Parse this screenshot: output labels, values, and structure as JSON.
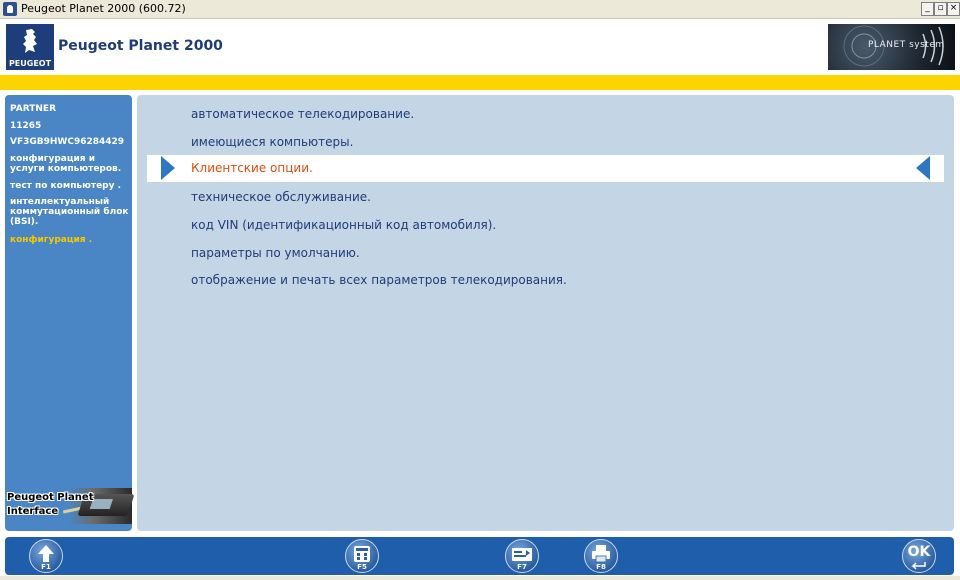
{
  "window": {
    "title": "Peugeot Planet 2000 (600.72)",
    "minimize_label": "_",
    "maximize_label": "▫",
    "close_label": "×"
  },
  "header": {
    "app_title": "Peugeot Planet 2000",
    "brand_text": "PEUGEOT",
    "logo_right_text": "PLANET system"
  },
  "sidebar": {
    "items": [
      {
        "label": "PARTNER"
      },
      {
        "label": "11265"
      },
      {
        "label": "VF3GB9HWC96284429"
      },
      {
        "label": "конфигурация и услуги компьютеров."
      },
      {
        "label": "тест по компьютеру ."
      },
      {
        "label": "интеллектуальный коммутационный блок (BSI)."
      },
      {
        "label": "конфигурация ."
      }
    ],
    "interface_text": "Peugeot Planet Interface"
  },
  "menu": {
    "items": [
      {
        "label": "автоматическое телекодирование."
      },
      {
        "label": "имеющиеся компьютеры."
      },
      {
        "label": "Клиентские опции."
      },
      {
        "label": "техническое обслуживание."
      },
      {
        "label": "код VIN (идентификационный код автомобиля)."
      },
      {
        "label": "параметры по умолчанию."
      },
      {
        "label": "отображение и печать всех параметров телекодирования."
      }
    ],
    "selected_index": 2
  },
  "toolbar": {
    "f1_label": "F1",
    "f5_label": "F5",
    "f7_label": "F7",
    "f8_label": "F8",
    "ok_label": "OK"
  },
  "icons": {
    "f1": "arrow-up-icon",
    "f5": "calculator-icon",
    "f7": "vin-card-icon",
    "f8": "printer-icon",
    "ok": "ok-enter-icon"
  },
  "colors": {
    "accent_yellow": "#fcd500",
    "sidebar_blue": "#4a86c5",
    "panel_bg": "#c4d6e6",
    "selected_text": "#e34a10",
    "active_sidebar": "#f7c800"
  }
}
